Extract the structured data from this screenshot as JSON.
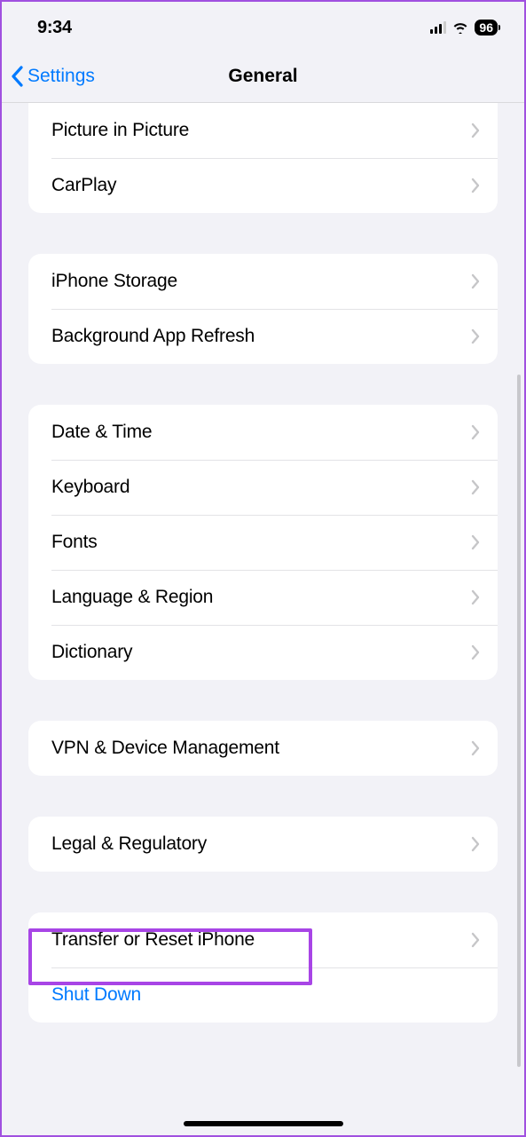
{
  "status": {
    "time": "9:34",
    "battery": "96"
  },
  "nav": {
    "back": "Settings",
    "title": "General"
  },
  "groups": [
    {
      "rows": [
        {
          "label": "Picture in Picture",
          "chevron": true
        },
        {
          "label": "CarPlay",
          "chevron": true
        }
      ]
    },
    {
      "rows": [
        {
          "label": "iPhone Storage",
          "chevron": true
        },
        {
          "label": "Background App Refresh",
          "chevron": true
        }
      ]
    },
    {
      "rows": [
        {
          "label": "Date & Time",
          "chevron": true
        },
        {
          "label": "Keyboard",
          "chevron": true
        },
        {
          "label": "Fonts",
          "chevron": true
        },
        {
          "label": "Language & Region",
          "chevron": true
        },
        {
          "label": "Dictionary",
          "chevron": true
        }
      ]
    },
    {
      "rows": [
        {
          "label": "VPN & Device Management",
          "chevron": true
        }
      ]
    },
    {
      "rows": [
        {
          "label": "Legal & Regulatory",
          "chevron": true
        }
      ]
    },
    {
      "rows": [
        {
          "label": "Transfer or Reset iPhone",
          "chevron": true
        },
        {
          "label": "Shut Down",
          "chevron": false,
          "link": true
        }
      ]
    }
  ]
}
